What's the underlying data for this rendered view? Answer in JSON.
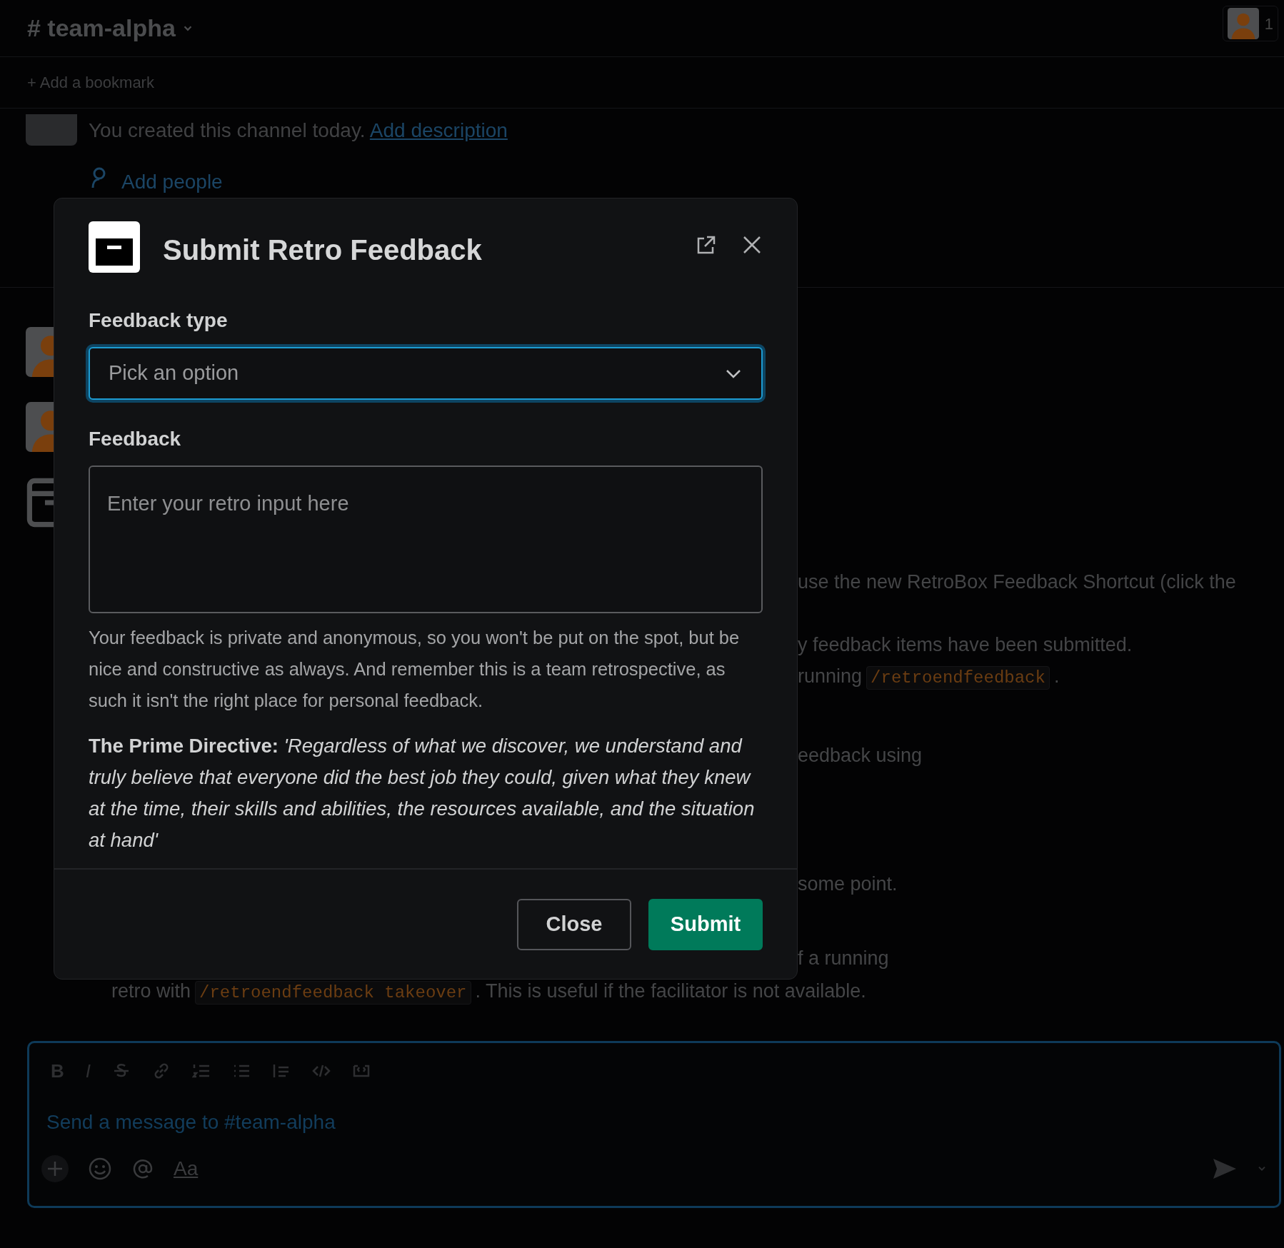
{
  "channel": {
    "prefix": "#",
    "name": "team-alpha",
    "member_count": "1"
  },
  "bookmark_bar": {
    "plus": "+",
    "label": "Add a bookmark"
  },
  "intro": {
    "text": "You created this channel today.",
    "link": "Add description",
    "add_people": "Add people"
  },
  "background_lines": [
    {
      "segments": [
        {
          "kind": "text",
          "text": "use the new RetroBox Feedback Shortcut (click the"
        }
      ]
    },
    {
      "segments": [
        {
          "kind": "text",
          "text": "y feedback items have been submitted."
        }
      ]
    },
    {
      "segments": [
        {
          "kind": "text",
          "text": "running"
        },
        {
          "kind": "code",
          "text": "/retroendfeedback"
        },
        {
          "kind": "text",
          "text": "."
        }
      ]
    },
    {
      "segments": [
        {
          "kind": "text",
          "text": "eedback using"
        }
      ]
    },
    {
      "segments": [
        {
          "kind": "text",
          "text": "some point."
        }
      ]
    },
    {
      "segments": [
        {
          "kind": "text",
          "text": "f a running"
        }
      ]
    },
    {
      "segments": [
        {
          "kind": "text",
          "text": "retro with"
        },
        {
          "kind": "code",
          "text": "/retroendfeedback takeover"
        },
        {
          "kind": "text",
          "text": ".  This is useful if the facilitator is not available."
        }
      ]
    }
  ],
  "modal": {
    "title": "Submit Retro Feedback",
    "fields": [
      {
        "kind": "select",
        "label": "Feedback type",
        "placeholder": "Pick an option",
        "focused": true
      },
      {
        "kind": "textarea",
        "label": "Feedback",
        "placeholder": "Enter your retro input here",
        "focused": false
      }
    ],
    "hint": "Your feedback is private and anonymous, so you won't be put on the spot, but be nice and constructive as always. And remember this is a team retrospective, as such it isn't the right place for personal feedback.",
    "directive": "**The Prime Directive:** *'Regardless of what we discover, we understand and truly believe that everyone did the best job they could, given what they knew at the time, their skills and abilities, the resources available, and the situation at hand'*",
    "buttons": [
      {
        "label": "Close",
        "kind": "secondary"
      },
      {
        "label": "Submit",
        "kind": "primary"
      }
    ]
  },
  "composer": {
    "format_letters": [
      "B",
      "I"
    ],
    "placeholder": "Send a message to #team-alpha",
    "text_format": "Aa"
  }
}
